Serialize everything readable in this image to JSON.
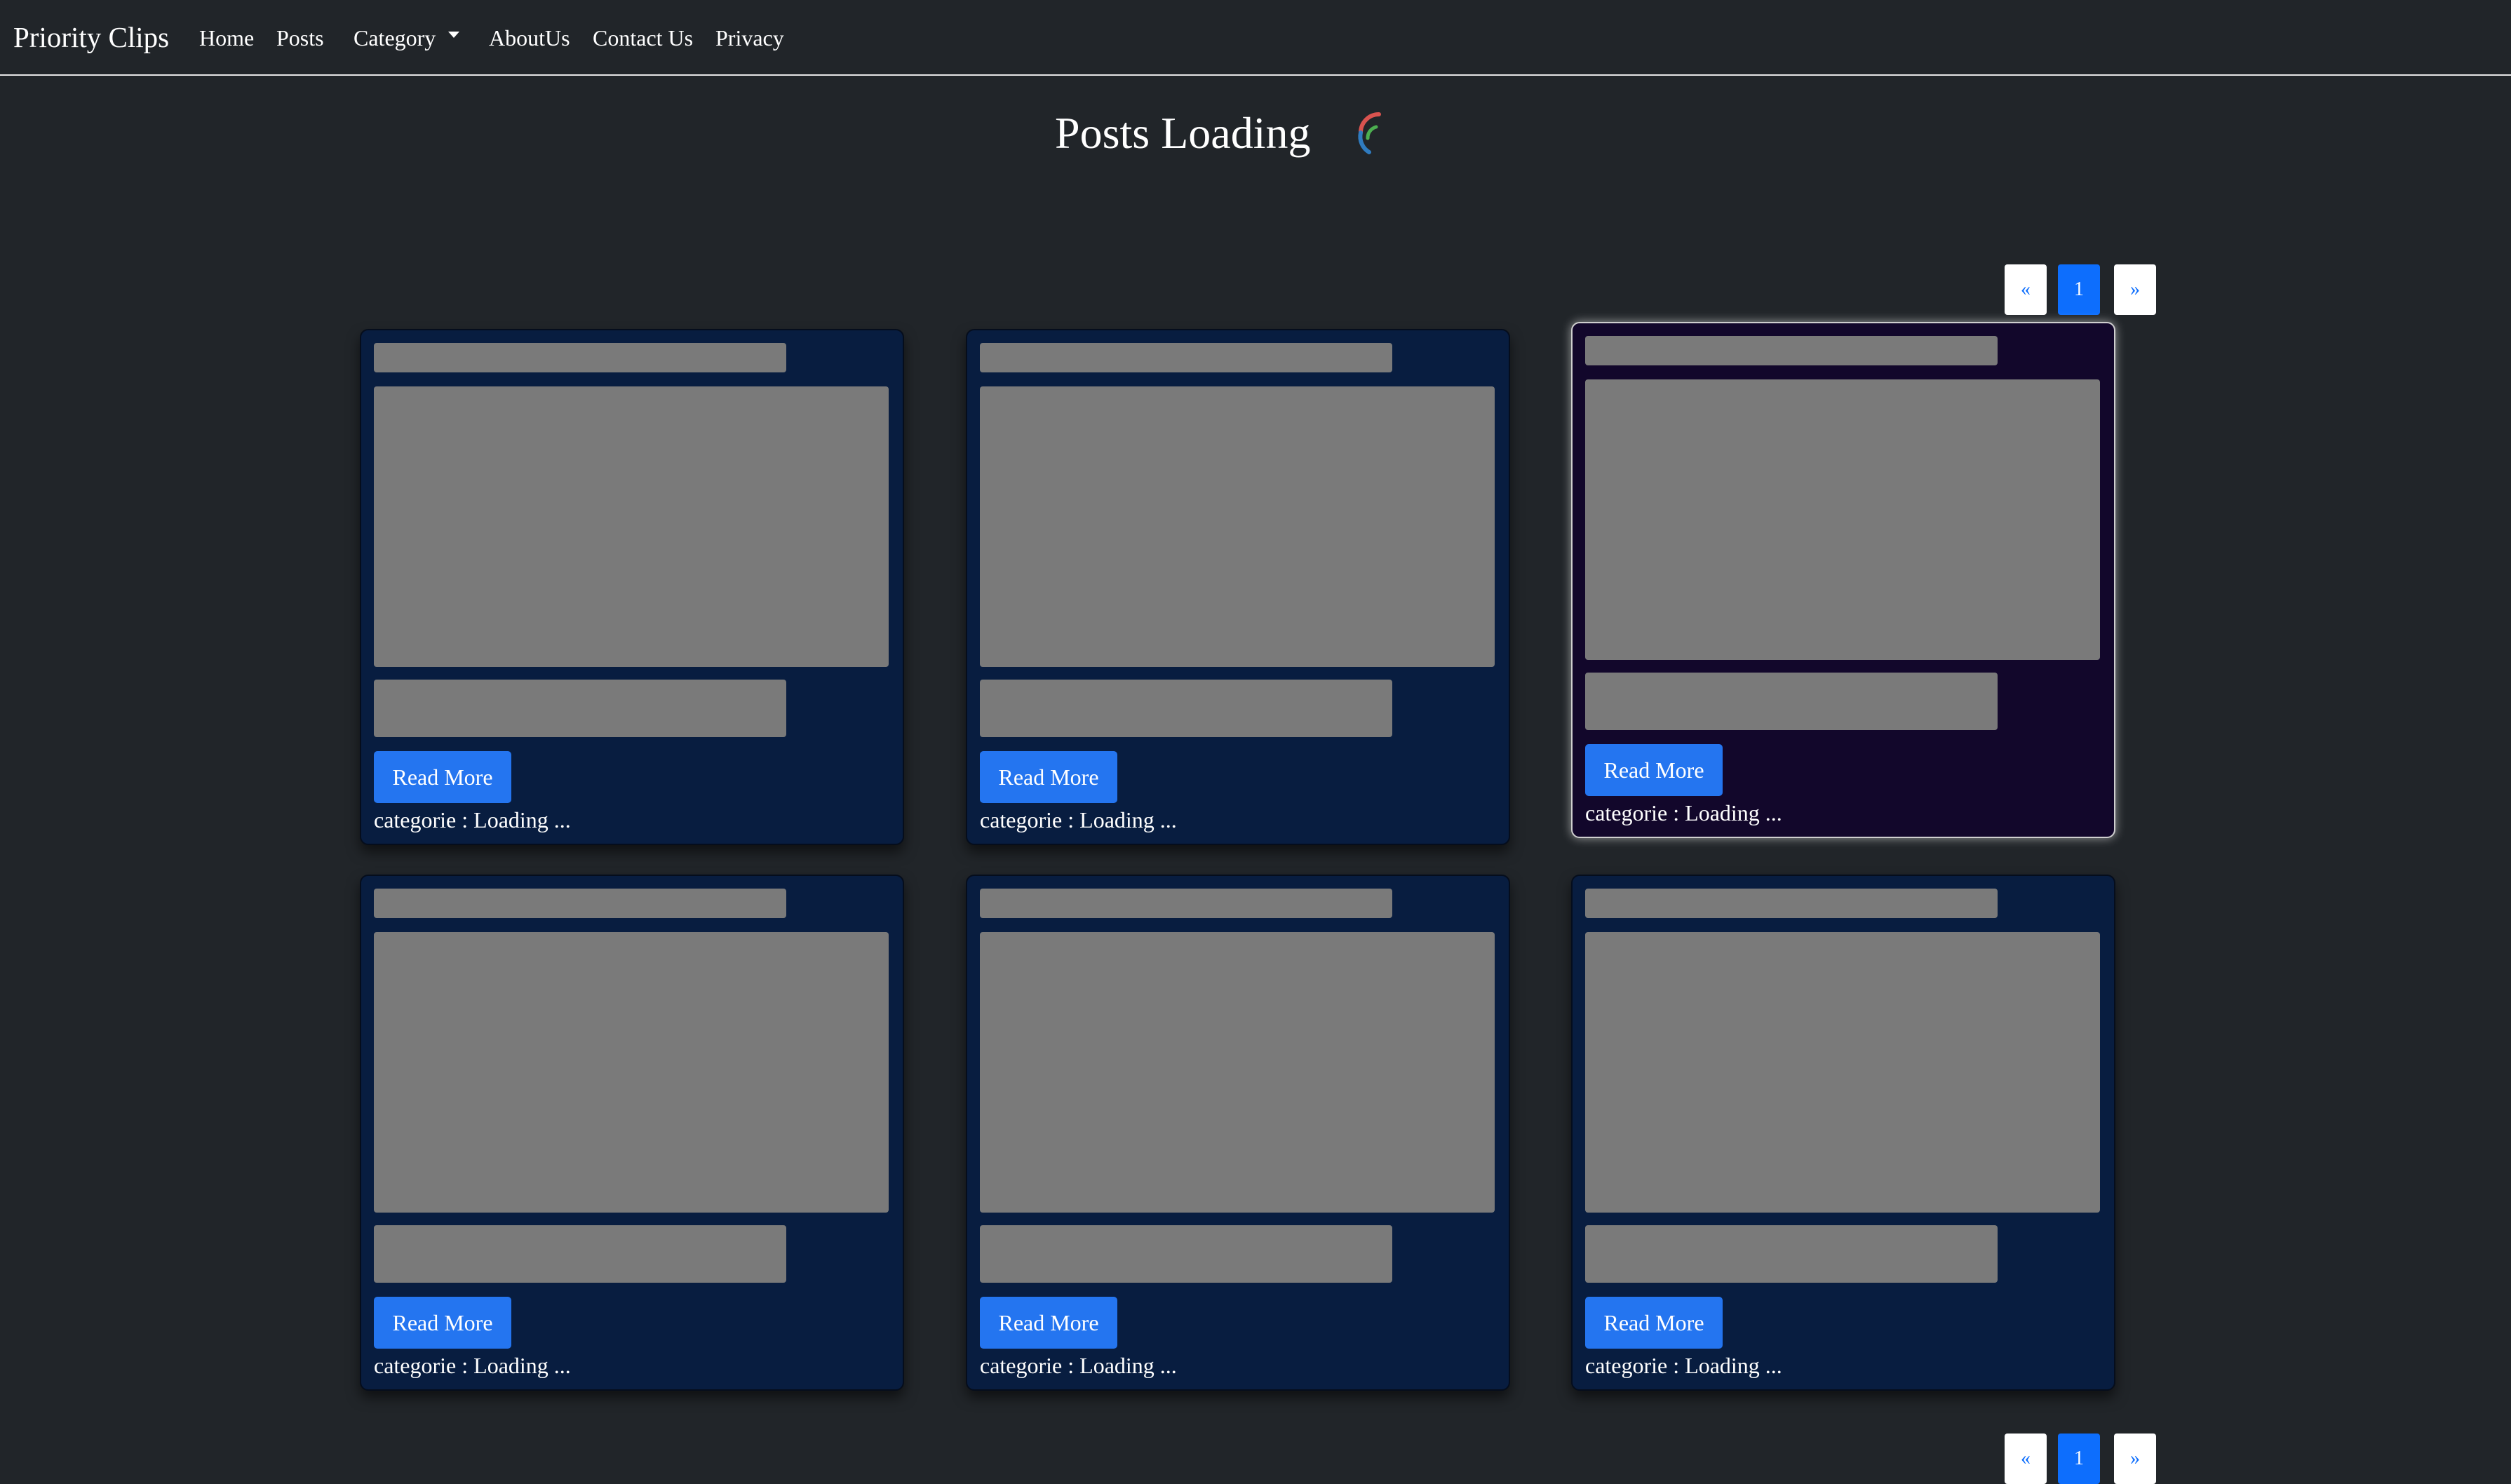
{
  "navbar": {
    "brand": "Priority Clips",
    "links": [
      {
        "label": "Home"
      },
      {
        "label": "Posts"
      },
      {
        "label": "Category"
      },
      {
        "label": "AboutUs"
      },
      {
        "label": "Contact Us"
      },
      {
        "label": "Privacy"
      }
    ]
  },
  "main": {
    "heading": "Posts Loading"
  },
  "pagination": {
    "prev": "«",
    "current": "1",
    "next": "»"
  },
  "cards": [
    {
      "button": "Read More",
      "category_text": "categorie : Loading ..."
    },
    {
      "button": "Read More",
      "category_text": "categorie : Loading ..."
    },
    {
      "button": "Read More",
      "category_text": "categorie : Loading ..."
    },
    {
      "button": "Read More",
      "category_text": "categorie : Loading ..."
    },
    {
      "button": "Read More",
      "category_text": "categorie : Loading ..."
    },
    {
      "button": "Read More",
      "category_text": "categorie : Loading ..."
    }
  ],
  "colors": {
    "page_background": "#212529",
    "card_background": "#081d40",
    "hovered_card_background": "#12072b",
    "placeholder": "#7a7a7a",
    "button": "#2475f0",
    "pagination_active": "#0d6efd"
  }
}
